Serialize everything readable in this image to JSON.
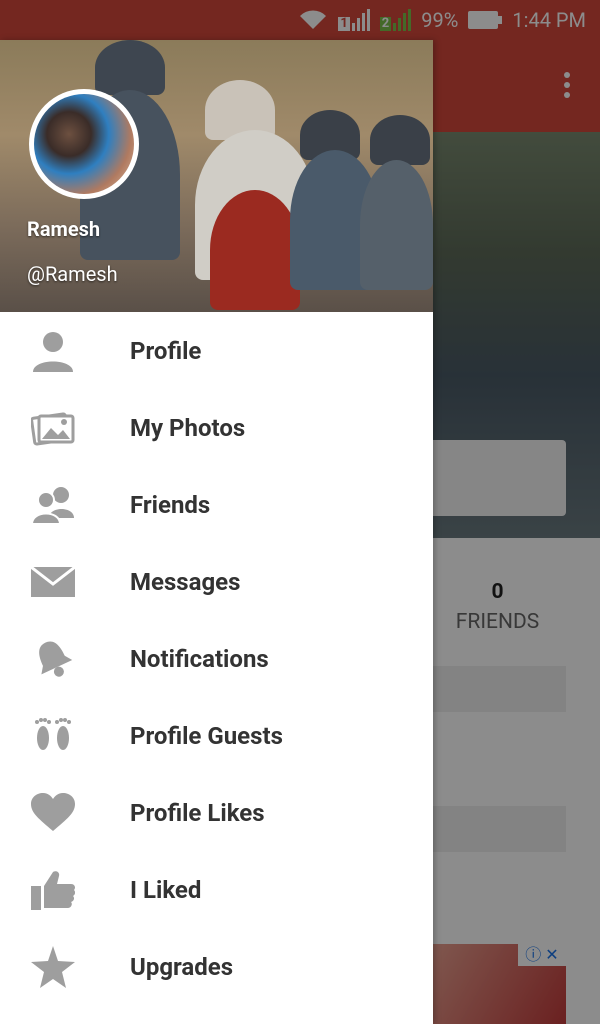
{
  "status_bar": {
    "battery": "99%",
    "time": "1:44 PM",
    "sim1": "1",
    "sim2": "2"
  },
  "drawer": {
    "user_name": "Ramesh",
    "user_handle": "@Ramesh",
    "items": [
      {
        "label": "Profile",
        "icon": "person-icon"
      },
      {
        "label": "My Photos",
        "icon": "photos-icon"
      },
      {
        "label": "Friends",
        "icon": "friends-icon"
      },
      {
        "label": "Messages",
        "icon": "envelope-icon"
      },
      {
        "label": "Notifications",
        "icon": "bell-icon"
      },
      {
        "label": "Profile Guests",
        "icon": "footprints-icon"
      },
      {
        "label": "Profile Likes",
        "icon": "heart-icon"
      },
      {
        "label": "I Liked",
        "icon": "thumbs-up-icon"
      },
      {
        "label": "Upgrades",
        "icon": "star-icon"
      }
    ]
  },
  "background": {
    "friends_count": "0",
    "friends_label": "FRIENDS"
  },
  "colors": {
    "accent": "#d4473b",
    "icon_gray": "#9e9e9e",
    "label_text": "#333333"
  }
}
